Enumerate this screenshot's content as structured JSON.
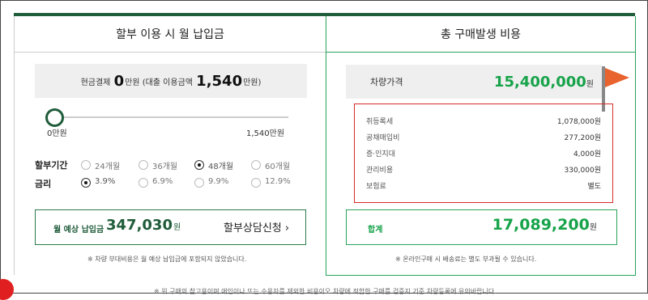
{
  "left": {
    "title": "할부 이용 시 월 납입금",
    "cash": {
      "prefix": "현금결제",
      "amount": "0",
      "unit1": "만원",
      "loan_label": "(대출 이용금액",
      "loan_amount": "1,540",
      "unit2": "만원)"
    },
    "slider": {
      "min_label": "0만원",
      "max_label": "1,540만원",
      "value_fraction": 0
    },
    "installment": {
      "label": "할부기간",
      "options": [
        "24개월",
        "36개월",
        "48개월",
        "60개월"
      ],
      "selected": "48개월"
    },
    "rate": {
      "label": "금리",
      "options": [
        "3.9%",
        "6.9%",
        "9.9%",
        "12.9%"
      ],
      "selected": "3.9%"
    },
    "monthly": {
      "label": "월 예상 납입금",
      "value": "347,030",
      "unit": "원",
      "consult_label": "할부상담신청",
      "consult_arrow": "›"
    },
    "note": "※ 차량 부대비용은 월 예상 납입금에 포함되지 않았습니다."
  },
  "right": {
    "title": "총 구매발생 비용",
    "price": {
      "label": "차량가격",
      "value": "15,400,000",
      "unit": "원"
    },
    "costs": [
      {
        "label": "취등록세",
        "value": "1,078,000원"
      },
      {
        "label": "공채매입비",
        "value": "277,200원"
      },
      {
        "label": "증·인지대",
        "value": "4,000원"
      },
      {
        "label": "관리비용",
        "value": "330,000원"
      },
      {
        "label": "보험료",
        "value": "별도"
      }
    ],
    "total": {
      "label": "합계",
      "value": "17,089,200",
      "unit": "원"
    },
    "note": "※ 온라인구매 시 배송료는 별도 부과될 수 있습니다."
  },
  "bottom_partial_text": "※ 위 구매의 참고용이며 애인이나 또는 수용자를 제외한 비용이오 차량에 적합한 구매를 검증지 기준 차량등록에 유의바랍니다.",
  "colors": {
    "green_dark": "#1f5c3a",
    "green_bright": "#17a34a",
    "red": "#d62b2b",
    "flag": "#e8632e"
  }
}
